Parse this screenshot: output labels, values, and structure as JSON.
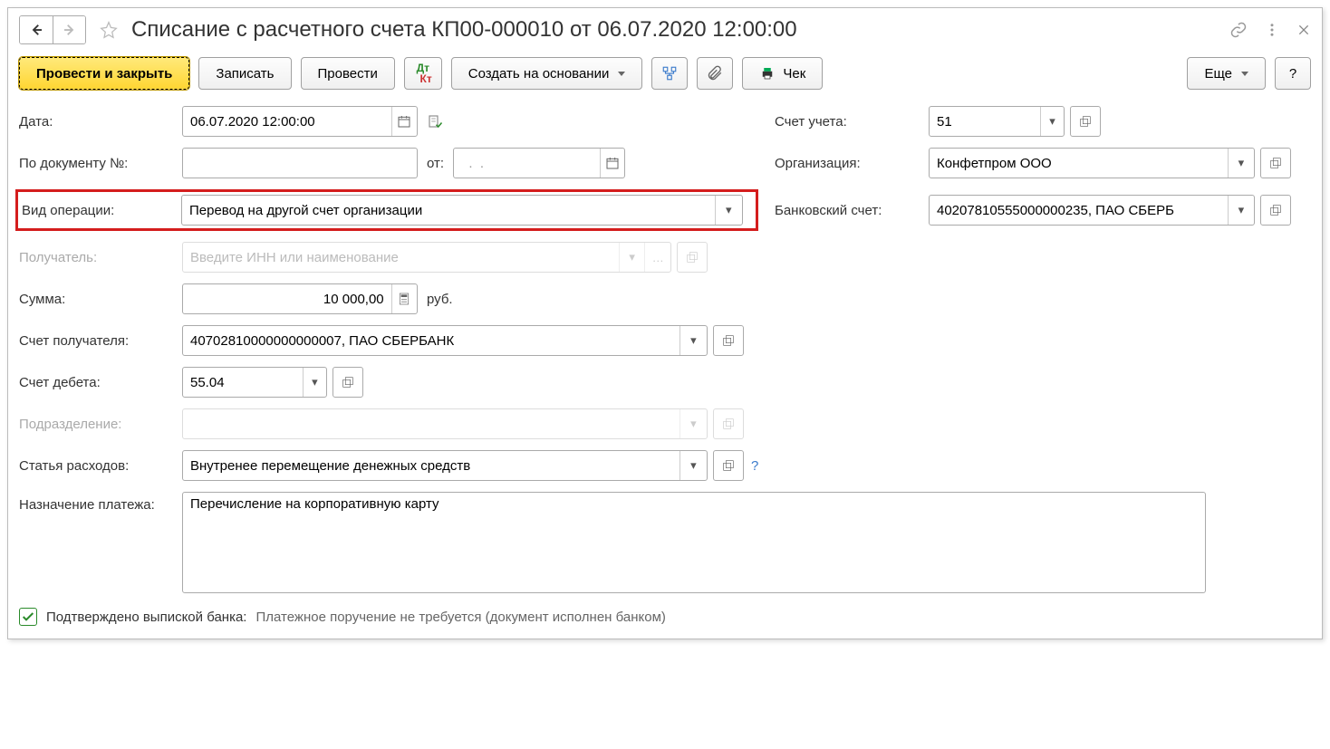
{
  "titlebar": {
    "title": "Списание с расчетного счета КП00-000010 от 06.07.2020 12:00:00"
  },
  "toolbar": {
    "post_and_close": "Провести и закрыть",
    "save": "Записать",
    "post": "Провести",
    "create_based": "Создать на основании",
    "check": "Чек",
    "more": "Еще",
    "help": "?"
  },
  "form": {
    "date_label": "Дата:",
    "date_value": "06.07.2020 12:00:00",
    "docnum_label": "По документу №:",
    "docnum_value": "",
    "docdate_label": "от:",
    "docdate_value": "  .  .    ",
    "account_label": "Счет учета:",
    "account_value": "51",
    "org_label": "Организация:",
    "org_value": "Конфетпром ООО",
    "optype_label": "Вид операции:",
    "optype_value": "Перевод на другой счет организации",
    "bankacc_label": "Банковский счет:",
    "bankacc_value": "40207810555000000235, ПАО СБЕРБ",
    "recipient_label": "Получатель:",
    "recipient_placeholder": "Введите ИНН или наименование",
    "sum_label": "Сумма:",
    "sum_value": "10 000,00",
    "sum_currency": "руб.",
    "recipient_acc_label": "Счет получателя:",
    "recipient_acc_value": "40702810000000000007, ПАО СБЕРБАНК",
    "debit_acc_label": "Счет дебета:",
    "debit_acc_value": "55.04",
    "division_label": "Подразделение:",
    "division_value": "",
    "expense_label": "Статья расходов:",
    "expense_value": "Внутренее перемещение денежных средств",
    "purpose_label": "Назначение платежа:",
    "purpose_value": "Перечисление на корпоративную карту",
    "confirmed_label": "Подтверждено выпиской банка:",
    "confirmed_note": "Платежное поручение не требуется (документ исполнен банком)"
  }
}
